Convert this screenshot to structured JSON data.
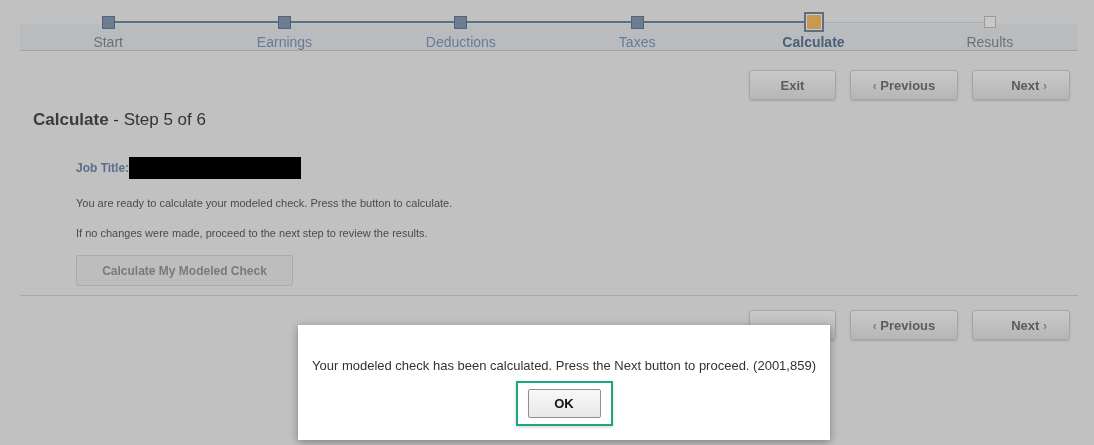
{
  "steps": [
    {
      "label": "Start",
      "kind": "complete",
      "link": false
    },
    {
      "label": "Earnings",
      "kind": "complete",
      "link": true
    },
    {
      "label": "Deductions",
      "kind": "complete",
      "link": true
    },
    {
      "label": "Taxes",
      "kind": "complete",
      "link": true
    },
    {
      "label": "Calculate",
      "kind": "current",
      "link": false
    },
    {
      "label": "Results",
      "kind": "pending",
      "link": false
    }
  ],
  "top_nav": {
    "exit": "Exit",
    "previous": "Previous",
    "next": "Next",
    "prev_glyph": "‹",
    "next_glyph": "›"
  },
  "heading": {
    "title": "Calculate",
    "subtitle": " - Step 5 of 6"
  },
  "job_title": {
    "label": "Job Title:",
    "redacted": true
  },
  "paragraphs": [
    "You are ready to calculate your modeled check. Press the button to calculate.",
    "If no changes were made, proceed to the next step to review the results."
  ],
  "calculate_button": {
    "label": "Calculate My Modeled Check",
    "disabled": true
  },
  "bottom_nav": {
    "previous": "Previous",
    "next": "Next",
    "prev_glyph": "‹",
    "next_glyph": "›"
  },
  "dialog": {
    "message": "Your modeled check has been calculated. Press the Next button to proceed. (2001,859)",
    "ok": "OK",
    "ok_focused": true
  }
}
